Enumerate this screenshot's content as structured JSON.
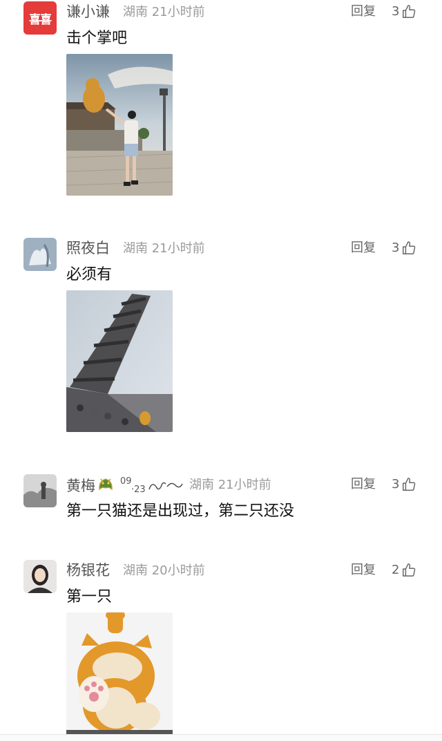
{
  "reply_label": "回复",
  "comments": [
    {
      "user": "谦小谦",
      "location": "湖南",
      "time": "21小时前",
      "likes": "3",
      "text": "击个掌吧",
      "avatar_text": "喜喜",
      "avatar_color": "#e43b3b"
    },
    {
      "user": "照夜白",
      "location": "湖南",
      "time": "21小时前",
      "likes": "3",
      "text": "必须有"
    },
    {
      "user": "黄梅",
      "badge_text": "09",
      "badge_text2": "·23",
      "location": "湖南",
      "time": "21小时前",
      "likes": "3",
      "text": "第一只猫还是出现过，第二只还没"
    },
    {
      "user": "杨银花",
      "location": "湖南",
      "time": "20小时前",
      "likes": "2",
      "text": "第一只"
    }
  ],
  "colors": {
    "meta": "#9a9a9a",
    "name": "#555555",
    "accent": "#e43b3b"
  }
}
